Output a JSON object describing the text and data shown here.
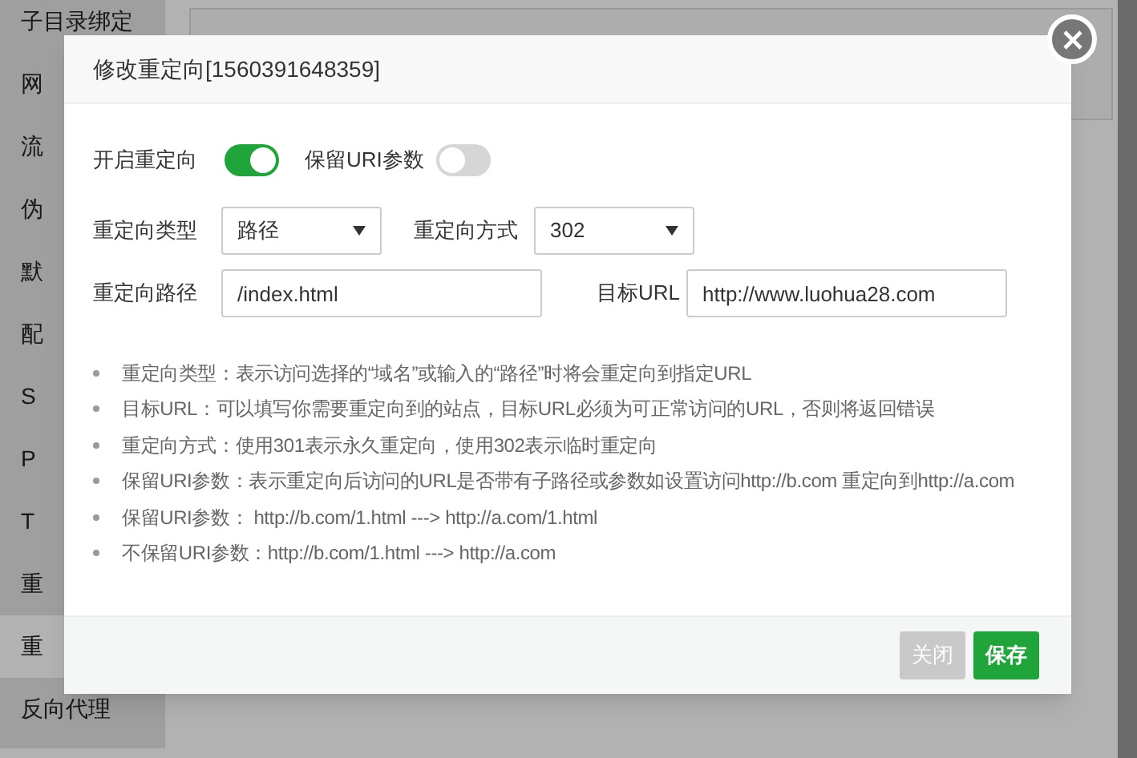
{
  "sidebar": {
    "items": [
      {
        "label": "子目录绑定",
        "selected": false
      },
      {
        "label": "网",
        "selected": false
      },
      {
        "label": "流",
        "selected": false
      },
      {
        "label": "伪",
        "selected": false
      },
      {
        "label": "默",
        "selected": false
      },
      {
        "label": "配",
        "selected": false
      },
      {
        "label": "S",
        "selected": false
      },
      {
        "label": "P",
        "selected": false
      },
      {
        "label": "T",
        "selected": false
      },
      {
        "label": "重",
        "selected": false
      },
      {
        "label": "重",
        "selected": true
      },
      {
        "label": "反向代理",
        "selected": false
      }
    ]
  },
  "dialog": {
    "title": "修改重定向[1560391648359]",
    "toggles": [
      {
        "label": "开启重定向",
        "on": true
      },
      {
        "label": "保留URI参数",
        "on": false
      }
    ],
    "selects": [
      {
        "label": "重定向类型",
        "value": "路径"
      },
      {
        "label": "重定向方式",
        "value": "302"
      }
    ],
    "fields": [
      {
        "label": "重定向路径",
        "value": "/index.html"
      },
      {
        "label": "目标URL",
        "value": "http://www.luohua28.com"
      }
    ],
    "notes": [
      "重定向类型：表示访问选择的“域名”或输入的“路径”时将会重定向到指定URL",
      "目标URL：可以填写你需要重定向到的站点，目标URL必须为可正常访问的URL，否则将返回错误",
      "重定向方式：使用301表示永久重定向，使用302表示临时重定向",
      "保留URI参数：表示重定向后访问的URL是否带有子路径或参数如设置访问http://b.com 重定向到http://a.com",
      "保留URI参数： http://b.com/1.html ---> http://a.com/1.html",
      "不保留URI参数：http://b.com/1.html ---> http://a.com"
    ],
    "buttons": [
      {
        "label": "关闭",
        "kind": "secondary"
      },
      {
        "label": "保存",
        "kind": "primary"
      }
    ]
  }
}
